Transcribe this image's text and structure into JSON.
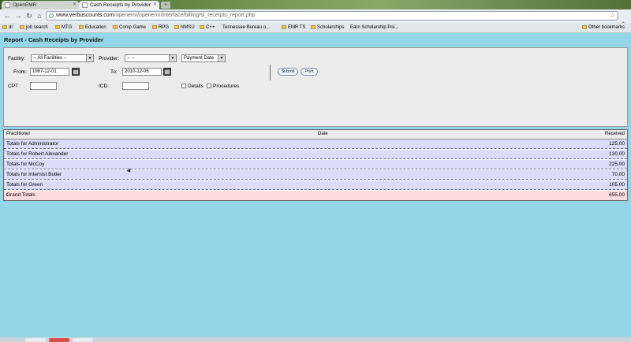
{
  "browser": {
    "tabs": [
      {
        "label": "OpenEMR"
      },
      {
        "label": "Cash Receipts by Provider"
      }
    ],
    "url": {
      "host": "www.verbuscounts.com",
      "path": "/openemr/openemr/interface/billing/sl_receipts_report.php"
    },
    "bookmarks": [
      "dl",
      "job search",
      "MTG",
      "Education",
      "Comp Game",
      "RPG",
      "NMSU",
      "C++",
      "Tennessee Bureau o...",
      "EMR TS",
      "Scholarships",
      "Earn Scholarship Poi..."
    ],
    "other_bookmarks": "Other bookmarks"
  },
  "report": {
    "title": "Report - Cash Receipts by Provider",
    "filters": {
      "facility_label": "Facility:",
      "facility_value": "-- All Facilities --",
      "provider_label": "Provider:",
      "provider_value": "-- --",
      "date_type_value": "Payment Date",
      "from_label": "From:",
      "from_value": "1987-12-01",
      "to_label": "To:",
      "to_value": "2010-12-06",
      "cpt_label": "CPT :",
      "cpt_value": "",
      "icd_label": "ICD :",
      "icd_value": "",
      "details_label": "Details",
      "procedures_label": "Procedures",
      "submit_label": "Submit",
      "print_label": "Print"
    },
    "table": {
      "headers": {
        "practitioner": "Practitioner",
        "date": "Date",
        "received": "Received"
      },
      "rows": [
        {
          "name": "Totals for Administrator",
          "value": "125.00"
        },
        {
          "name": "Totals for Robert Alexander",
          "value": "130.00"
        },
        {
          "name": "Totals for McCoy",
          "value": "225.00"
        },
        {
          "name": "Totals for Internist Butler",
          "value": "70.00"
        },
        {
          "name": "Totals for Green",
          "value": "105.00"
        }
      ],
      "grand_total": {
        "name": "Grand Totals",
        "value": "655.00"
      }
    }
  },
  "colors": {
    "page_bg": "#95d6e6",
    "row_bg": "#dcdcf8",
    "grand_total_bg": "#fcdcdc"
  }
}
